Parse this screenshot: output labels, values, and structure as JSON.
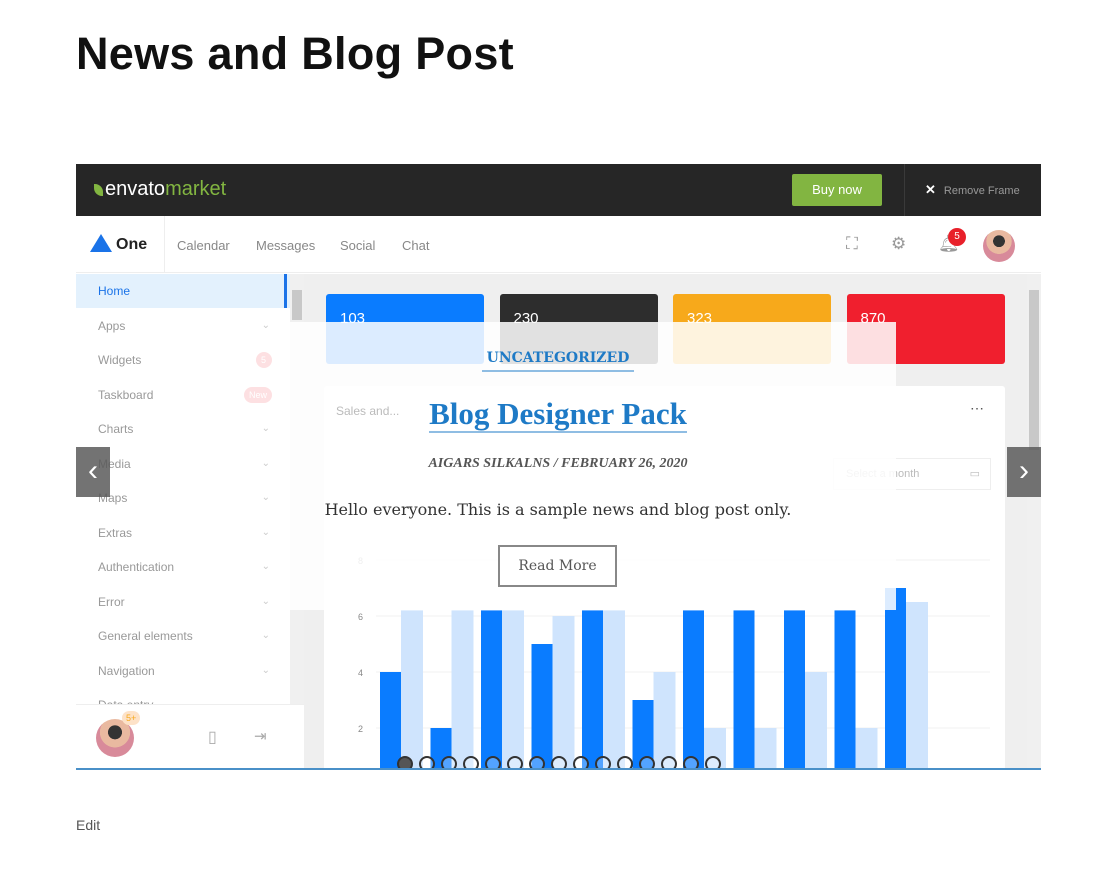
{
  "page": {
    "title": "News and Blog Post",
    "edit_link": "Edit"
  },
  "frame": {
    "logo_bold": "envato",
    "logo_light": "market",
    "buy_label": "Buy now",
    "remove_label": "Remove Frame"
  },
  "app": {
    "brand": "One",
    "nav": [
      "Calendar",
      "Messages",
      "Social",
      "Chat"
    ],
    "notification_count": "5",
    "sidebar": [
      {
        "label": "Home",
        "active": true
      },
      {
        "label": "Apps"
      },
      {
        "label": "Widgets",
        "badge": "5"
      },
      {
        "label": "Taskboard",
        "badge": "New"
      },
      {
        "label": "Charts"
      },
      {
        "label": "Media"
      },
      {
        "label": "Maps"
      },
      {
        "label": "Extras"
      },
      {
        "label": "Authentication"
      },
      {
        "label": "Error"
      },
      {
        "label": "General elements"
      },
      {
        "label": "Navigation"
      },
      {
        "label": "Data entry"
      }
    ],
    "user_badge": "5+",
    "stats": [
      {
        "value": "103",
        "color": "#0a7cff"
      },
      {
        "value": "230",
        "color": "#2d2d2d"
      },
      {
        "value": "323",
        "color": "#f7a91b"
      },
      {
        "value": "870",
        "color": "#f01f2e"
      }
    ],
    "chart": {
      "card_title": "Sales and...",
      "select_placeholder": "Select a month",
      "y_ticks": [
        "2",
        "4",
        "6",
        "8"
      ],
      "dark": [
        4,
        2,
        6.2,
        5,
        6.2,
        3,
        6.2,
        6.2,
        6.2,
        6.2,
        7,
        0.5
      ],
      "light": [
        6.2,
        6.2,
        6.2,
        6,
        6.2,
        4,
        2,
        2,
        4,
        2,
        6.5,
        0.5
      ],
      "dark_color": "#0a7cff",
      "light_color": "#cfe4fd"
    }
  },
  "post": {
    "category": "UNCATEGORIZED",
    "title": "Blog Designer Pack",
    "author": "AIGARS SILKALNS",
    "separator": "/",
    "date": "FEBRUARY 26, 2020",
    "excerpt": "Hello everyone. This is a sample news and blog post only.",
    "read_more": "Read More"
  },
  "slider": {
    "slide_count": 15,
    "active_slide": 1,
    "prev_icon": "chevron-left",
    "next_icon": "chevron-right"
  }
}
